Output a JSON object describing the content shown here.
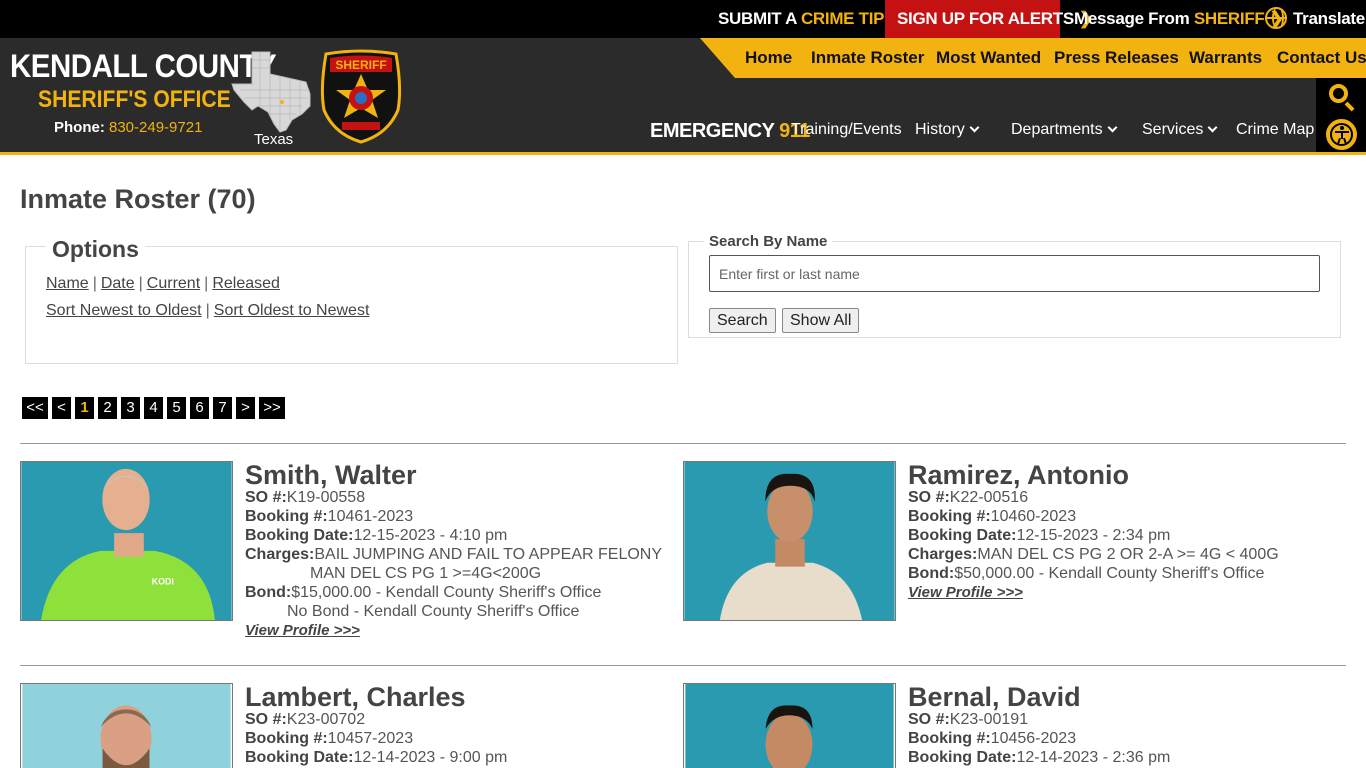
{
  "topbar": {
    "crime_tip_a": "SUBMIT A ",
    "crime_tip_b": "CRIME TIP",
    "alerts": "SIGN UP FOR ALERTS",
    "message_a": "Message From ",
    "message_b": "SHERIFF",
    "translate": "Translate"
  },
  "brand": {
    "title": "KENDALL COUNTY",
    "subtitle": "SHERIFF'S OFFICE",
    "phone_label": "Phone: ",
    "phone_number": "830-249-9721",
    "state_label": "Texas"
  },
  "nav": {
    "primary": [
      "Home",
      "Inmate Roster",
      "Most Wanted",
      "Press Releases",
      "Warrants",
      "Contact Us"
    ],
    "emergency_a": "EMERGENCY ",
    "emergency_b": "911",
    "secondary": [
      "Training/Events",
      "History",
      "Departments",
      "Services",
      "Crime Map"
    ]
  },
  "page": {
    "title": "Inmate Roster (70)"
  },
  "options": {
    "legend": "Options",
    "row1": [
      "Name",
      "Date",
      "Current",
      "Released"
    ],
    "row2": [
      "Sort Newest to Oldest",
      "Sort Oldest to Newest"
    ]
  },
  "search": {
    "legend": "Search By Name",
    "placeholder": "Enter first or last name",
    "search_button": "Search",
    "show_all_button": "Show All"
  },
  "pager": [
    "<<",
    "<",
    "1",
    "2",
    "3",
    "4",
    "5",
    "6",
    "7",
    ">",
    ">>"
  ],
  "labels": {
    "so": "SO #:",
    "booking_no": "Booking #:",
    "booking_date": "Booking Date:",
    "charges": "Charges:",
    "bond": "Bond:",
    "view_profile": "View Profile >>>"
  },
  "inmates": [
    {
      "name": "Smith, Walter",
      "so": "K19-00558",
      "booking_no": "10461-2023",
      "booking_date": "12-15-2023 - 4:10 pm",
      "charges": [
        "BAIL JUMPING AND FAIL TO APPEAR FELONY",
        "MAN DEL CS PG 1 >=4G<200G"
      ],
      "bonds": [
        "$15,000.00 - Kendall County Sheriff's Office",
        "No Bond - Kendall County Sheriff's Office"
      ]
    },
    {
      "name": "Ramirez, Antonio",
      "so": "K22-00516",
      "booking_no": "10460-2023",
      "booking_date": "12-15-2023 - 2:34 pm",
      "charges": [
        "MAN DEL CS PG 2 OR 2-A >= 4G < 400G"
      ],
      "bonds": [
        "$50,000.00 - Kendall County Sheriff's Office"
      ]
    },
    {
      "name": "Lambert, Charles",
      "so": "K23-00702",
      "booking_no": "10457-2023",
      "booking_date": "12-14-2023 - 9:00 pm"
    },
    {
      "name": "Bernal, David",
      "so": "K23-00191",
      "booking_no": "10456-2023",
      "booking_date": "12-14-2023 - 2:36 pm"
    }
  ],
  "colors": {
    "accent": "#f2b310",
    "alert_red": "#c41212",
    "header_dark": "#2b2b2b",
    "photo_backdrop": "#2a9ab0"
  }
}
